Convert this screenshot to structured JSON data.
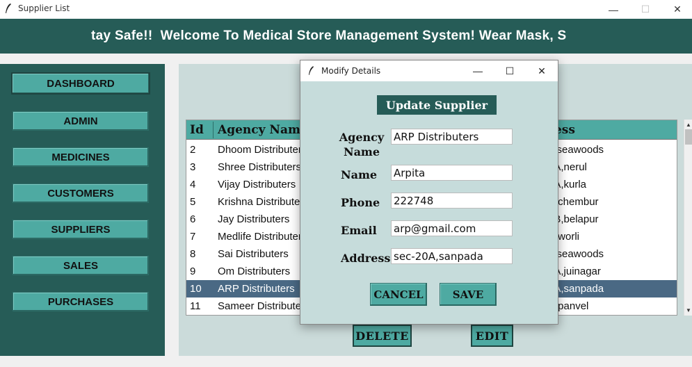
{
  "window": {
    "title": "Supplier List",
    "minimize_glyph": "—",
    "maximize_glyph": "☐",
    "close_glyph": "✕"
  },
  "banner": {
    "text": "tay Safe!!  Welcome To Medical Store Management System! Wear Mask, S"
  },
  "sidebar": {
    "items": [
      {
        "label": "DASHBOARD"
      },
      {
        "label": "ADMIN"
      },
      {
        "label": "MEDICINES"
      },
      {
        "label": "CUSTOMERS"
      },
      {
        "label": "SUPPLIERS"
      },
      {
        "label": "SALES"
      },
      {
        "label": "PURCHASES"
      }
    ]
  },
  "table": {
    "columns": [
      "Id",
      "Agency Name",
      "ress"
    ],
    "rows": [
      {
        "id": "2",
        "agency": "Dhoom Distributer",
        "address": "4,seawoods"
      },
      {
        "id": "3",
        "agency": "Shree Distributers",
        "address": "6A,nerul"
      },
      {
        "id": "4",
        "agency": "Vijay Distributers",
        "address": "0A,kurla"
      },
      {
        "id": "5",
        "agency": "Krishna Distributer",
        "address": "B,chembur"
      },
      {
        "id": "6",
        "agency": "Jay Distributers",
        "address": "0B,belapur"
      },
      {
        "id": "7",
        "agency": "Medlife Distributers",
        "address": "B,worli"
      },
      {
        "id": "8",
        "agency": "Sai Distributers",
        "address": "4,seawoods"
      },
      {
        "id": "9",
        "agency": "Om Distributers",
        "address": "6A,juinagar"
      },
      {
        "id": "10",
        "agency": "ARP Distributers",
        "address": "0A,sanpada"
      },
      {
        "id": "11",
        "agency": "Sameer Distribute",
        "address": "B,panvel"
      }
    ],
    "selected_row_id": "10"
  },
  "actions": {
    "delete_label": "DELETE",
    "edit_label": "EDIT"
  },
  "dialog": {
    "title": "Modify Details",
    "heading": "Update Supplier",
    "fields": {
      "agency_label": "Agency Name",
      "agency_value": "ARP Distributers",
      "name_label": "Name",
      "name_value": "Arpita",
      "phone_label": "Phone",
      "phone_value": "222748",
      "email_label": "Email",
      "email_value": "arp@gmail.com",
      "address_label": "Address",
      "address_value": "sec-20A,sanpada"
    },
    "cancel_label": "CANCEL",
    "save_label": "SAVE"
  },
  "colors": {
    "dark_teal": "#265c57",
    "accent_teal": "#4eaaa2",
    "panel_bg": "#cbdbda",
    "dialog_bg": "#c6dcdb",
    "selected_row": "#4a6984"
  }
}
